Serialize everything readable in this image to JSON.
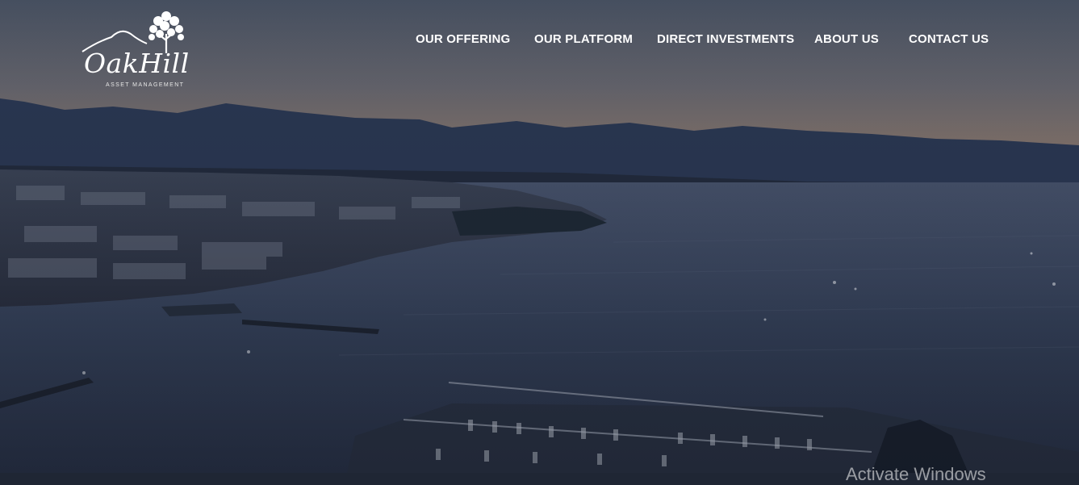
{
  "brand": {
    "name": "OakHill",
    "tagline": "ASSET MANAGEMENT"
  },
  "nav": {
    "items": [
      {
        "label": "OUR OFFERING"
      },
      {
        "label": "OUR PLATFORM"
      },
      {
        "label": "DIRECT INVESTMENTS"
      },
      {
        "label": "ABOUT US"
      },
      {
        "label": "CONTACT US"
      }
    ]
  },
  "overlay_text": {
    "os_watermark": "Activate Windows"
  },
  "colors": {
    "nav_text": "#ffffff",
    "sky_top": "#4a5566",
    "sky_horizon": "#8a7a72",
    "mountains": "#2b3a55",
    "lake": "#323f57"
  }
}
